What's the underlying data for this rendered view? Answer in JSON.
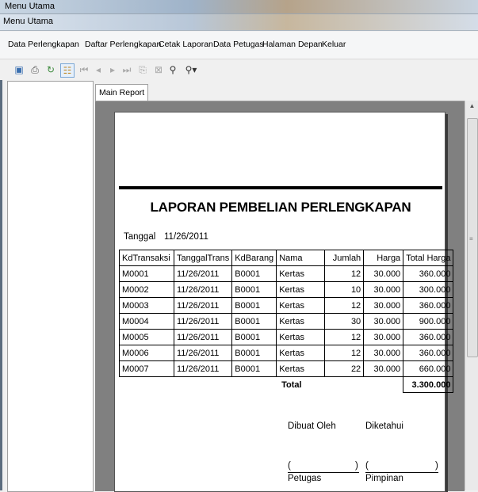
{
  "window": {
    "outer_title": "Menu Utama",
    "inner_title": "Menu Utama"
  },
  "menu": [
    "Data Perlengkapan",
    "Daftar Perlengkapan",
    "Cetak Laporan",
    "Data Petugas",
    "Halaman Depan",
    "Keluar"
  ],
  "toolbar": {
    "icons": [
      "export-icon",
      "print-icon",
      "refresh-icon",
      "toggle-tree-icon",
      "first-page-icon",
      "previous-page-icon",
      "next-page-icon",
      "last-page-icon",
      "goto-page-icon",
      "stop-icon",
      "find-icon",
      "zoom-icon"
    ]
  },
  "tabs": [
    "Main Report"
  ],
  "report": {
    "title": "LAPORAN PEMBELIAN PERLENGKAPAN",
    "date_label": "Tanggal",
    "date_value": "11/26/2011",
    "columns": [
      "KdTransaksi",
      "TanggalTrans",
      "KdBarang",
      "Nama",
      "Jumlah",
      "Harga",
      "Total Harga"
    ],
    "rows": [
      [
        "M0001",
        "11/26/2011",
        "B0001",
        "Kertas",
        "12",
        "30.000",
        "360.000"
      ],
      [
        "M0002",
        "11/26/2011",
        "B0001",
        "Kertas",
        "10",
        "30.000",
        "300.000"
      ],
      [
        "M0003",
        "11/26/2011",
        "B0001",
        "Kertas",
        "12",
        "30.000",
        "360.000"
      ],
      [
        "M0004",
        "11/26/2011",
        "B0001",
        "Kertas",
        "30",
        "30.000",
        "900.000"
      ],
      [
        "M0005",
        "11/26/2011",
        "B0001",
        "Kertas",
        "12",
        "30.000",
        "360.000"
      ],
      [
        "M0006",
        "11/26/2011",
        "B0001",
        "Kertas",
        "12",
        "30.000",
        "360.000"
      ],
      [
        "M0007",
        "11/26/2011",
        "B0001",
        "Kertas",
        "22",
        "30.000",
        "660.000"
      ]
    ],
    "total_label": "Total",
    "total_value": "3.300.000",
    "made_by_label": "Dibuat Oleh",
    "known_by_label": "Diketahui",
    "paren_open": "(",
    "paren_close": ")",
    "officer_label": "Petugas",
    "leader_label": "Pimpinan"
  }
}
